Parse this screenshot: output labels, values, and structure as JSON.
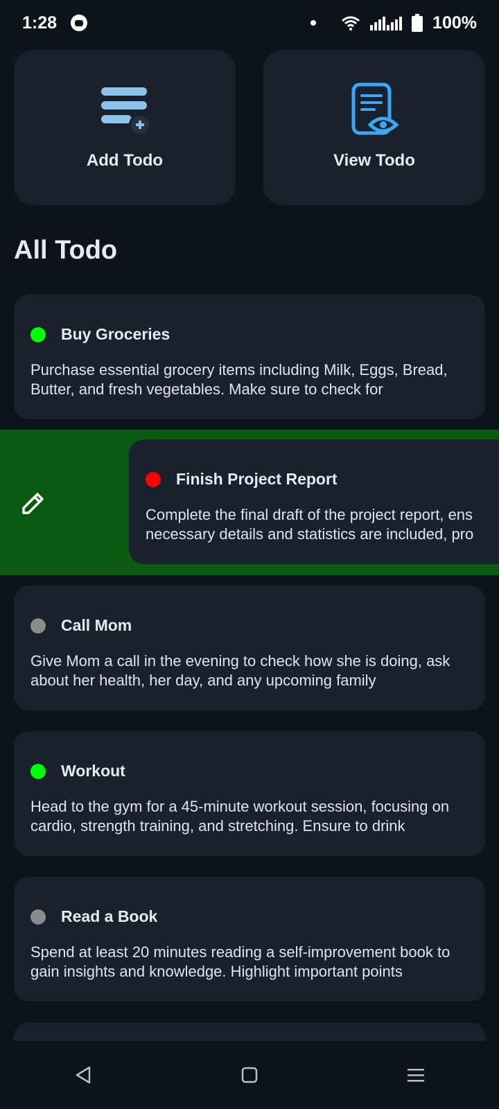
{
  "status_bar": {
    "time": "1:28",
    "battery": "100%",
    "icons": [
      "cat-notification-icon",
      "wifi-icon",
      "signal-icon",
      "battery-icon"
    ]
  },
  "actions": {
    "add": {
      "label": "Add Todo",
      "icon": "add-list-icon"
    },
    "view": {
      "label": "View Todo",
      "icon": "view-document-icon"
    }
  },
  "section_title": "All Todo",
  "colors": {
    "priority_high": "#ff0000",
    "priority_low": "#00ff00",
    "priority_none": "#8a8a8a",
    "swipe_background": "#0c5a12",
    "card_background": "#18212c",
    "accent_blue": "#3ea7f5"
  },
  "todos": [
    {
      "title": "Buy Groceries",
      "status": "green",
      "desc": "Purchase essential grocery items including Milk, Eggs, Bread, Butter, and fresh vegetables. Make sure to check for"
    },
    {
      "title": "Finish Project Report",
      "status": "red",
      "desc_line1": "Complete the final draft of the project report, ens",
      "desc_line2": "necessary details and statistics are included, pro"
    },
    {
      "title": "Call Mom",
      "status": "gray",
      "desc": "Give Mom a call in the evening to check how she is doing, ask about her health, her day, and any upcoming family"
    },
    {
      "title": "Workout",
      "status": "green",
      "desc": "Head to the gym for a 45-minute workout session, focusing on cardio, strength training, and stretching. Ensure to drink"
    },
    {
      "title": "Read a Book",
      "status": "gray",
      "desc": "Spend at least 20 minutes reading a self-improvement book to gain insights and knowledge. Highlight important points"
    }
  ],
  "swipe_action": {
    "icon": "edit-pencil-icon"
  },
  "nav": {
    "back": "back-icon",
    "home": "home-icon",
    "recents": "menu-icon"
  }
}
